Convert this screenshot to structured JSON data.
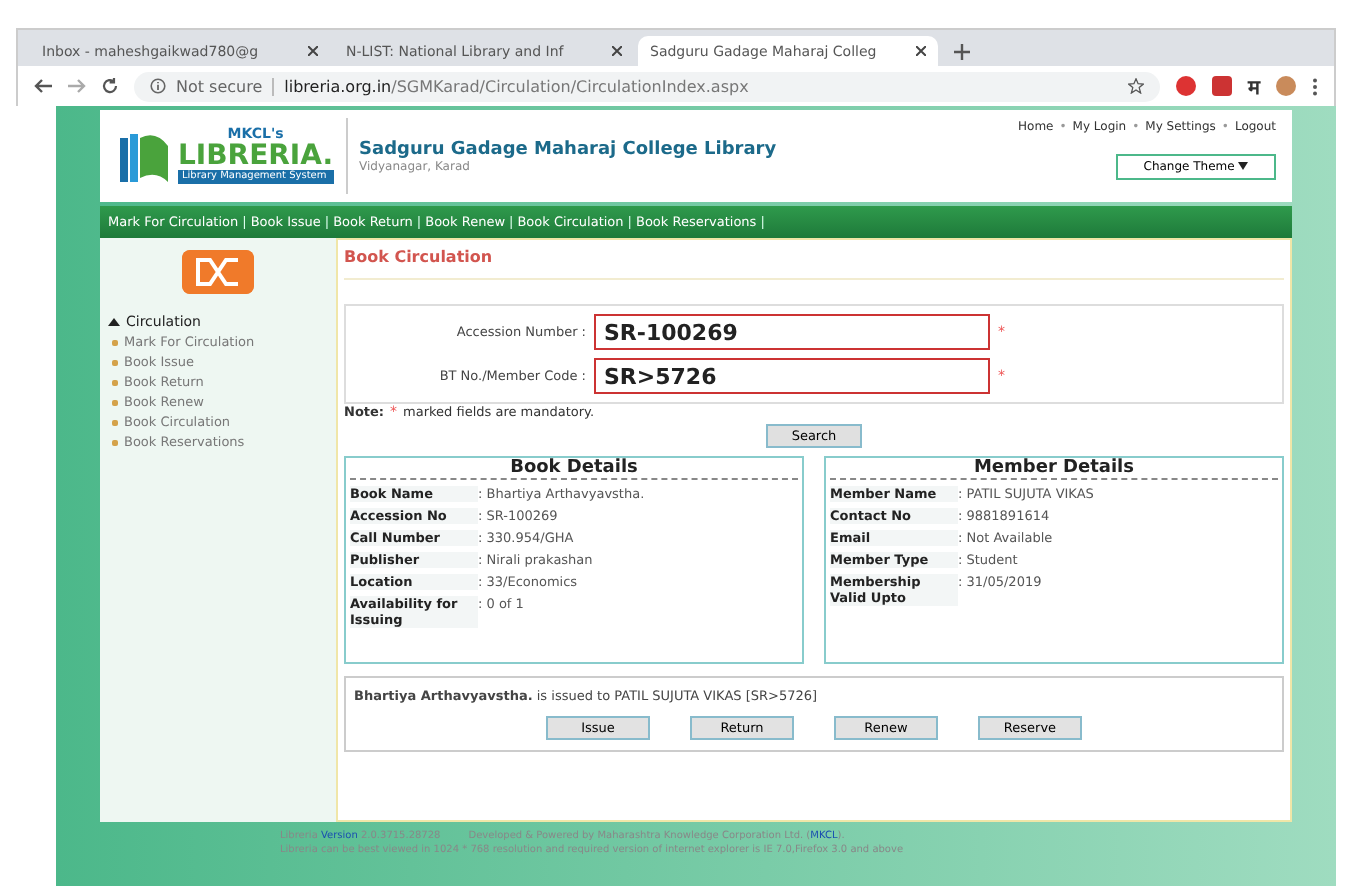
{
  "browser": {
    "tabs": [
      {
        "title": "Inbox - maheshgaikwad780@g",
        "selected": false
      },
      {
        "title": "N-LIST: National Library and Inf",
        "selected": false
      },
      {
        "title": "Sadguru Gadage Maharaj Colleg",
        "selected": true
      }
    ],
    "security": "Not secure",
    "url_host": "libreria.org.in",
    "url_path": "/SGMKarad/Circulation/CirculationIndex.aspx",
    "extension_letter": "म"
  },
  "header": {
    "logo_top": "MKCL's",
    "logo_name": "LIBRERIA.",
    "logo_sub": "Library Management System",
    "college": "Sadguru Gadage Maharaj College Library",
    "place": "Vidyanagar, Karad",
    "links": [
      "Home",
      "My Login",
      "My Settings",
      "Logout"
    ],
    "link_separator": "•",
    "theme_button": "Change Theme"
  },
  "nav": {
    "items": [
      "Mark For Circulation",
      "Book Issue",
      "Book Return",
      "Book Renew",
      "Book Circulation",
      "Book Reservations"
    ],
    "separator": "|"
  },
  "sidebar": {
    "heading": "Circulation",
    "expanded": true,
    "items": [
      "Mark For Circulation",
      "Book Issue",
      "Book Return",
      "Book Renew",
      "Book Circulation",
      "Book Reservations"
    ]
  },
  "content": {
    "title": "Book Circulation",
    "fields": [
      {
        "label": "Accession Number :",
        "value": "SR-100269",
        "required_mark": "*"
      },
      {
        "label": "BT No./Member Code :",
        "value": "SR>5726",
        "required_mark": "*"
      }
    ],
    "note_label": "Note:",
    "note_mark": "*",
    "note_text": "marked fields are mandatory.",
    "search_button": "Search",
    "book_details": {
      "title": "Book Details",
      "rows": [
        {
          "label": "Book Name",
          "value": ": Bhartiya Arthavyavstha."
        },
        {
          "label": "Accession No",
          "value": ": SR-100269"
        },
        {
          "label": "Call Number",
          "value": ": 330.954/GHA"
        },
        {
          "label": "Publisher",
          "value": ": Nirali prakashan"
        },
        {
          "label": "Location",
          "value": ": 33/Economics"
        },
        {
          "label": "Availability for Issuing",
          "value": ": 0 of 1"
        }
      ]
    },
    "member_details": {
      "title": "Member Details",
      "rows": [
        {
          "label": "Member Name",
          "value": ": PATIL SUJUTA VIKAS"
        },
        {
          "label": "Contact No",
          "value": ": 9881891614"
        },
        {
          "label": "Email",
          "value": ": Not Available"
        },
        {
          "label": "Member Type",
          "value": ": Student"
        },
        {
          "label": "Membership Valid Upto",
          "value": ": 31/05/2019"
        }
      ]
    },
    "message": "**Bhartiya Arthavyavstha.** is issued to PATIL SUJUTA VIKAS [SR>5726]",
    "actions": [
      "Issue",
      "Return",
      "Renew",
      "Reserve"
    ]
  },
  "footer": {
    "app": "Libreria",
    "version_link": "Version",
    "version": "2.0.3715.28728",
    "credit_before": "Developed & Powered by Maharashtra Knowledge Corporation Ltd. (",
    "credit_link": "MKCL",
    "credit_after": ").",
    "note": "Libreria can be best viewed in 1024 * 768 resolution and required version of internet explorer is IE 7.0,Firefox 3.0 and above"
  }
}
